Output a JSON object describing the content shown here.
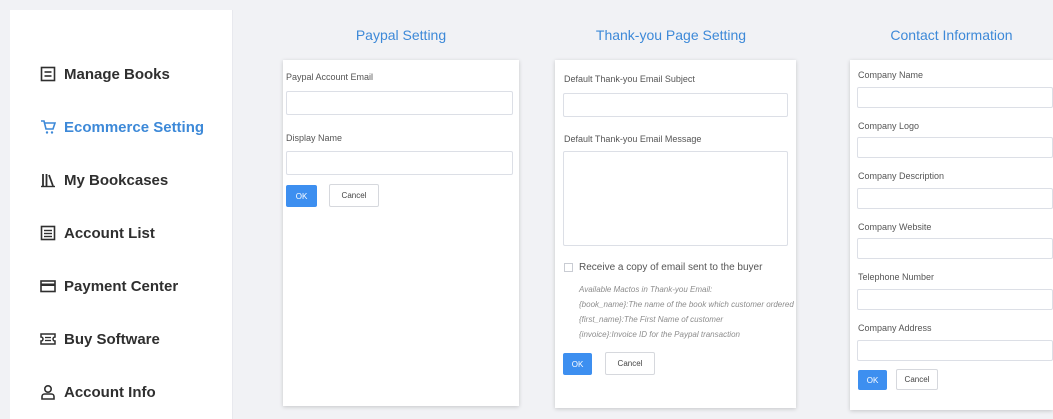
{
  "sidebar": {
    "items": [
      {
        "label": "Manage Books",
        "icon": "book-list-icon"
      },
      {
        "label": "Ecommerce Setting",
        "icon": "cart-icon",
        "active": true
      },
      {
        "label": "My Bookcases",
        "icon": "bookcase-icon"
      },
      {
        "label": "Account List",
        "icon": "list-icon"
      },
      {
        "label": "Payment Center",
        "icon": "card-icon"
      },
      {
        "label": "Buy Software",
        "icon": "ticket-icon"
      },
      {
        "label": "Account Info",
        "icon": "user-icon"
      }
    ]
  },
  "paypal": {
    "title": "Paypal Setting",
    "email_label": "Paypal Account Email",
    "email_value": "",
    "display_name_label": "Display Name",
    "display_name_value": "",
    "ok": "OK",
    "cancel": "Cancel"
  },
  "thankyou": {
    "title": "Thank-you Page Setting",
    "subject_label": "Default Thank-you Email Subject",
    "subject_value": "",
    "message_label": "Default Thank-you Email Message",
    "message_value": "",
    "copy_label": "Receive a copy of email sent to the buyer",
    "copy_checked": false,
    "macros_title": "Available Mactos in Thank-you Email:",
    "macros": [
      "{book_name}:The name of the book which customer ordered",
      "{first_name}:The First Name of customer",
      "{invoice}:Invoice ID for the Paypal transaction"
    ],
    "ok": "OK",
    "cancel": "Cancel"
  },
  "contact": {
    "title": "Contact Information",
    "fields": [
      {
        "label": "Company Name",
        "value": ""
      },
      {
        "label": "Company Logo",
        "value": ""
      },
      {
        "label": "Company Description",
        "value": ""
      },
      {
        "label": "Company Website",
        "value": ""
      },
      {
        "label": "Telephone Number",
        "value": ""
      },
      {
        "label": "Company Address",
        "value": ""
      }
    ],
    "ok": "OK",
    "cancel": "Cancel"
  },
  "colors": {
    "accent": "#3d89d8",
    "button": "#3d8ff0",
    "background": "#f1f2f5"
  }
}
